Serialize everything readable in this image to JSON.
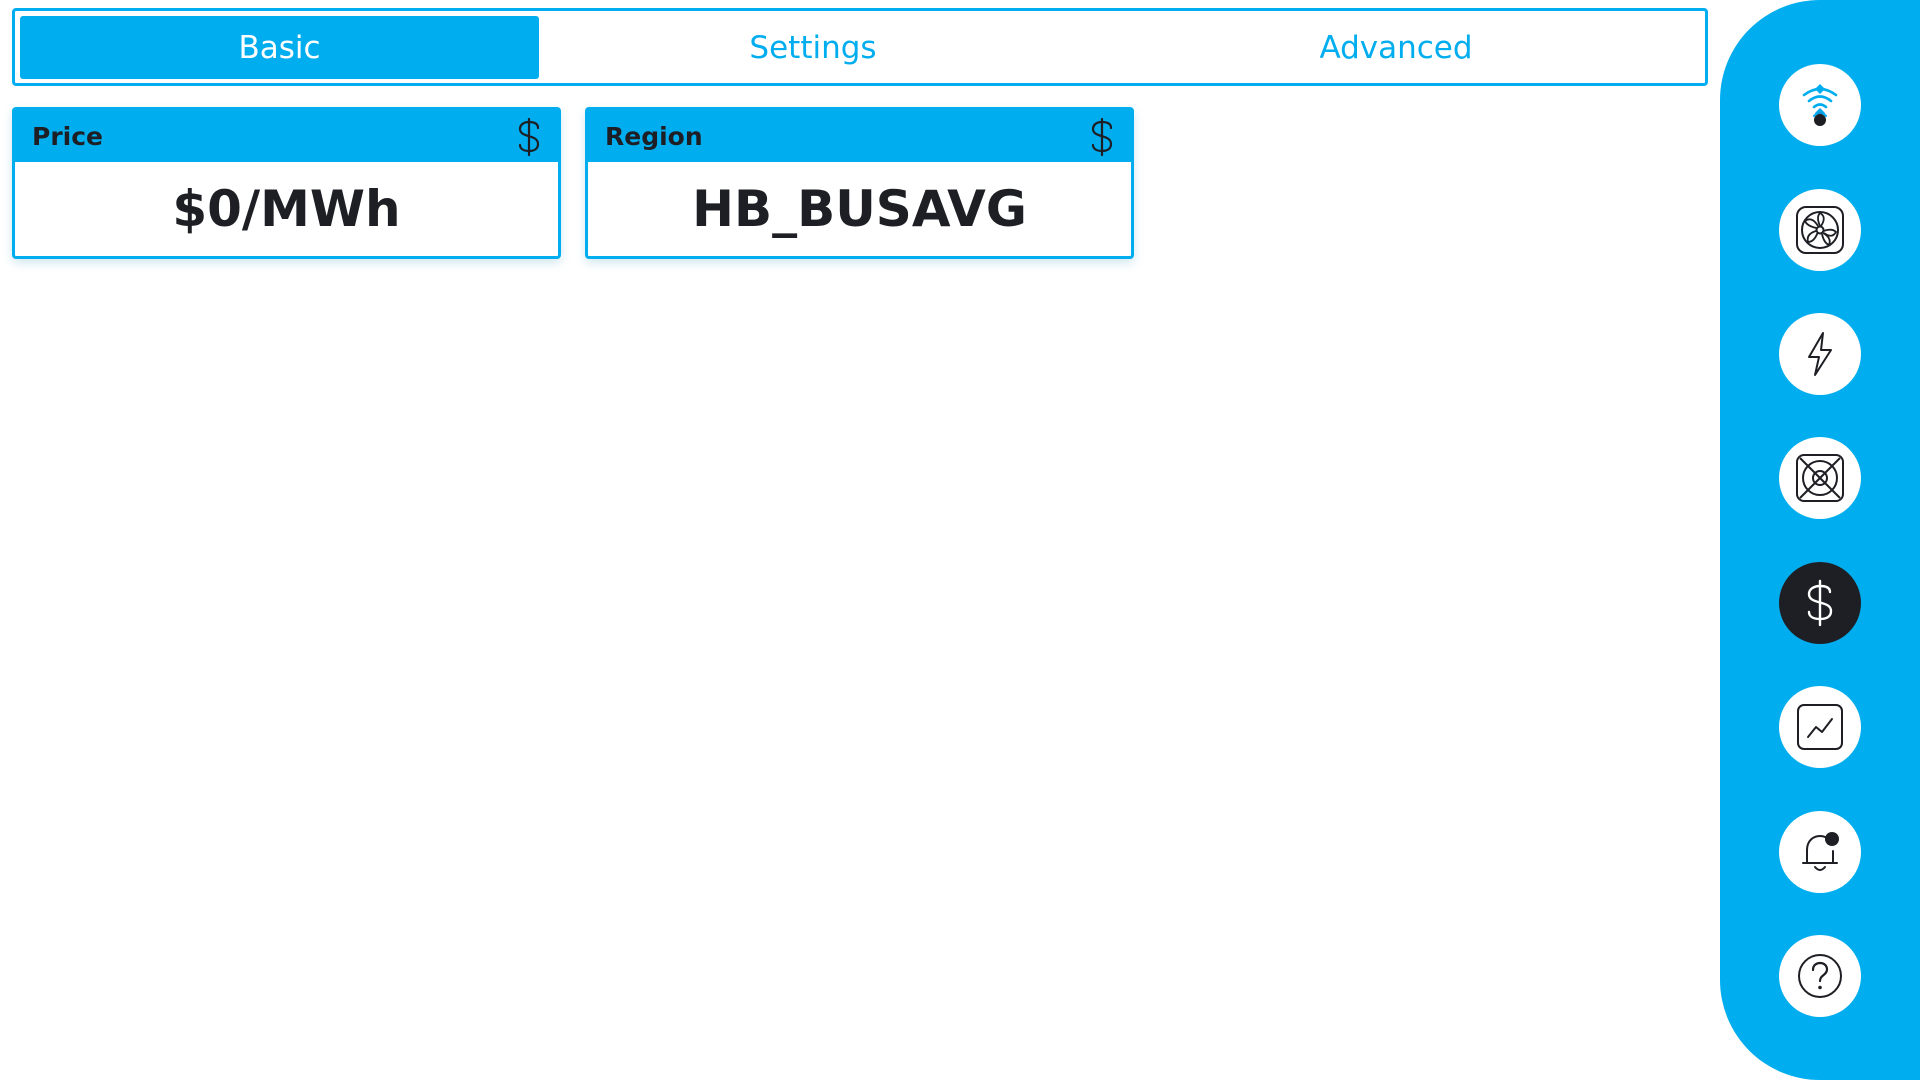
{
  "tabs": [
    {
      "label": "Basic",
      "active": true
    },
    {
      "label": "Settings",
      "active": false
    },
    {
      "label": "Advanced",
      "active": false
    }
  ],
  "cards": {
    "price": {
      "title": "Price",
      "value": "$0/MWh",
      "icon": "dollar-icon"
    },
    "region": {
      "title": "Region",
      "value": "HB_BUSAVG",
      "icon": "dollar-icon"
    }
  },
  "sidebar": {
    "items": [
      {
        "icon": "wifi-pool-icon",
        "active": false
      },
      {
        "icon": "fan-icon",
        "active": false
      },
      {
        "icon": "lightning-icon",
        "active": false
      },
      {
        "icon": "miner-unit-icon",
        "active": false
      },
      {
        "icon": "dollar-icon",
        "active": true
      },
      {
        "icon": "chart-icon",
        "active": false
      },
      {
        "icon": "bell-icon",
        "active": false
      },
      {
        "icon": "help-icon",
        "active": false
      }
    ]
  },
  "colors": {
    "accent": "#00adef",
    "dark": "#1e1f24",
    "background": "#ffffff"
  }
}
